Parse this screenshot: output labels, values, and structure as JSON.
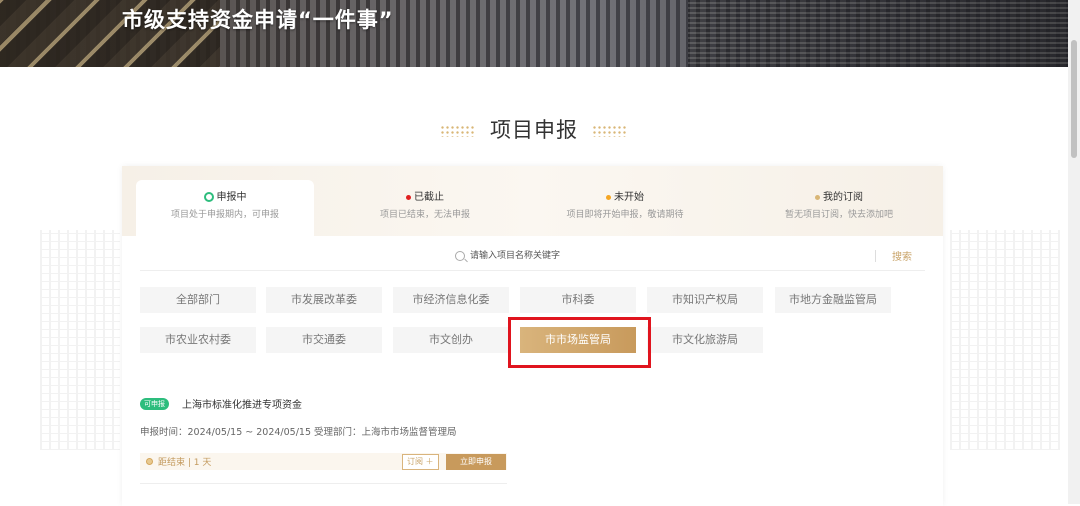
{
  "banner": {
    "title": "市级支持资金申请“一件事”"
  },
  "section": {
    "title": "项目申报"
  },
  "tabs": [
    {
      "label": "申报中",
      "desc": "项目处于申报期内，可申报",
      "color": "#2dbd7d",
      "active": true
    },
    {
      "label": "已截止",
      "desc": "项目已结束，无法申报",
      "color": "#e02020",
      "active": false
    },
    {
      "label": "未开始",
      "desc": "项目即将开始申报，敬请期待",
      "color": "#f5a623",
      "active": false
    },
    {
      "label": "我的订阅",
      "desc": "暂无项目订阅，快去添加吧",
      "color": "#d9b676",
      "active": false
    }
  ],
  "search": {
    "placeholder": "请输入项目名称关键字",
    "button": "搜索"
  },
  "departments": [
    "全部部门",
    "市发展改革委",
    "市经济信息化委",
    "市科委",
    "市知识产权局",
    "市地方金融监管局",
    "市农业农村委",
    "市交通委",
    "市文创办",
    "市市场监管局",
    "市文化旅游局"
  ],
  "selected_department": "市市场监管局",
  "project": {
    "badge": "可申报",
    "title": "上海市标准化推进专项资金",
    "meta": "申报时间：2024/05/15 ~ 2024/05/15    受理部门：上海市市场监督管理局",
    "remaining": "距结束 | 1 天",
    "subscribe": "订阅 ＋",
    "apply": "立即申报"
  },
  "colors": {
    "accent": "#c89a5c",
    "active_green": "#2dbd7d",
    "highlight": "#e0141e"
  }
}
